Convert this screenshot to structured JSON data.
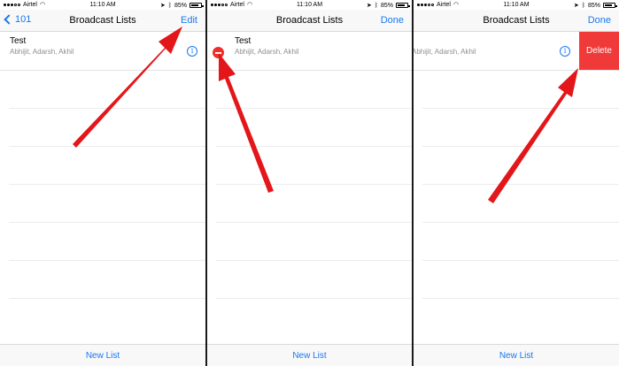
{
  "status": {
    "carrier": "Airtel",
    "time": "11:10 AM",
    "battery": "85%",
    "battery_level": 0.85
  },
  "screens": [
    {
      "nav_back_label": "101",
      "nav_title": "Broadcast Lists",
      "nav_action": "Edit",
      "row_title": "Test",
      "row_members": "Abhijit, Adarsh, Akhil",
      "bottom_action": "New List"
    },
    {
      "nav_title": "Broadcast Lists",
      "nav_action": "Done",
      "row_title": "Test",
      "row_members": "Abhijit, Adarsh, Akhil",
      "bottom_action": "New List"
    },
    {
      "nav_title": "Broadcast Lists",
      "nav_action": "Done",
      "row_members": "Abhijit, Adarsh, Akhil",
      "delete_label": "Delete",
      "bottom_action": "New List"
    }
  ],
  "info_glyph": "i",
  "colors": {
    "accent": "#1878f3",
    "destructive": "#f03a3a",
    "annotation_arrow": "#e3161a"
  }
}
